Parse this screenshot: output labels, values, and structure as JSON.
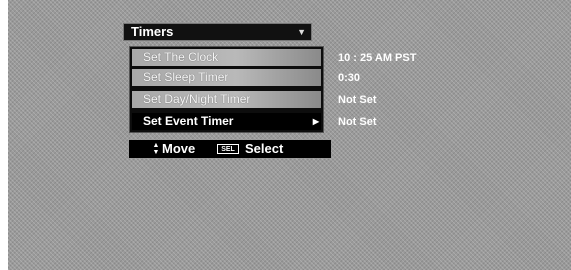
{
  "menu": {
    "title": "Timers",
    "items": [
      {
        "label": "Set The Clock",
        "value": "10 : 25 AM PST"
      },
      {
        "label": "Set Sleep Timer",
        "value": "0:30"
      },
      {
        "label": "Set Day/Night Timer",
        "value": "Not Set"
      },
      {
        "label": "Set Event Timer",
        "value": "Not Set"
      }
    ]
  },
  "footer": {
    "move_label": "Move",
    "sel_key": "SEL",
    "select_label": "Select"
  },
  "icons": {
    "title_dropdown": "triangle-down-icon",
    "submenu": "triangle-right-icon",
    "move": "up-down-arrows-icon"
  }
}
